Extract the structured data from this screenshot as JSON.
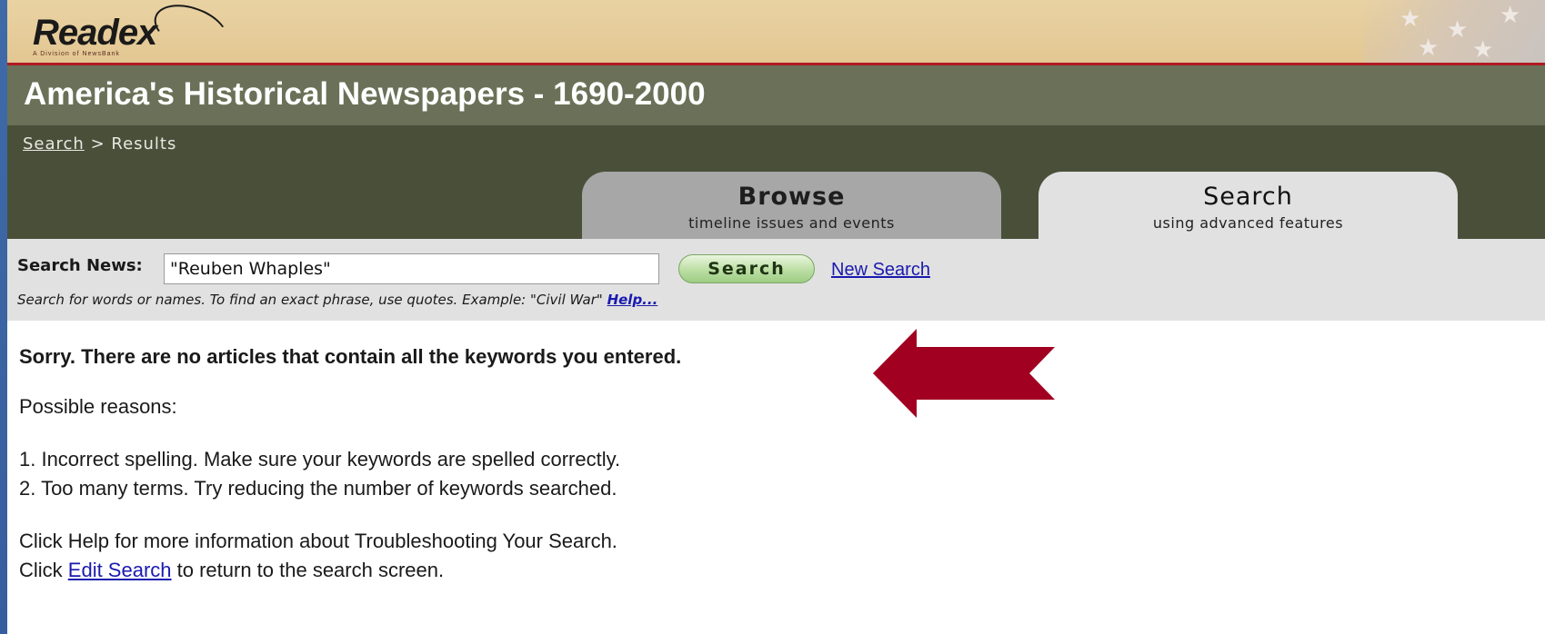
{
  "banner": {
    "logo_text": "Readex",
    "logo_subtitle": "A Division of NewsBank"
  },
  "header": {
    "title": "America's Historical Newspapers - 1690-2000"
  },
  "breadcrumb": {
    "link": "Search",
    "separator": " > ",
    "current": "Results"
  },
  "tabs": [
    {
      "title": "Browse",
      "subtitle": "timeline issues and events"
    },
    {
      "title": "Search",
      "subtitle": "using advanced features"
    }
  ],
  "search": {
    "label": "Search News:",
    "value": "\"Reuben Whaples\"",
    "button_label": "Search",
    "new_search_label": "New Search",
    "hint": "Search for words or names. To find an exact phrase, use quotes. Example: \"Civil War\"",
    "help_link": "Help..."
  },
  "results": {
    "message": "Sorry. There are no articles that contain all the keywords you entered.",
    "reasons_heading": "Possible reasons:",
    "reasons": [
      "1. Incorrect spelling. Make sure your keywords are spelled correctly.",
      "2. Too many terms. Try reducing the number of keywords searched."
    ],
    "help_line": "Click Help for more information about Troubleshooting Your Search.",
    "edit_prefix": "Click ",
    "edit_link": "Edit Search",
    "edit_suffix": " to return to the search screen."
  },
  "colors": {
    "arrow": "#a10020",
    "title_bar": "#6a7158",
    "nav_band": "#4a4f3a",
    "banner": "#e5cb96"
  },
  "icons": {
    "arrow": "left-arrow-icon"
  }
}
